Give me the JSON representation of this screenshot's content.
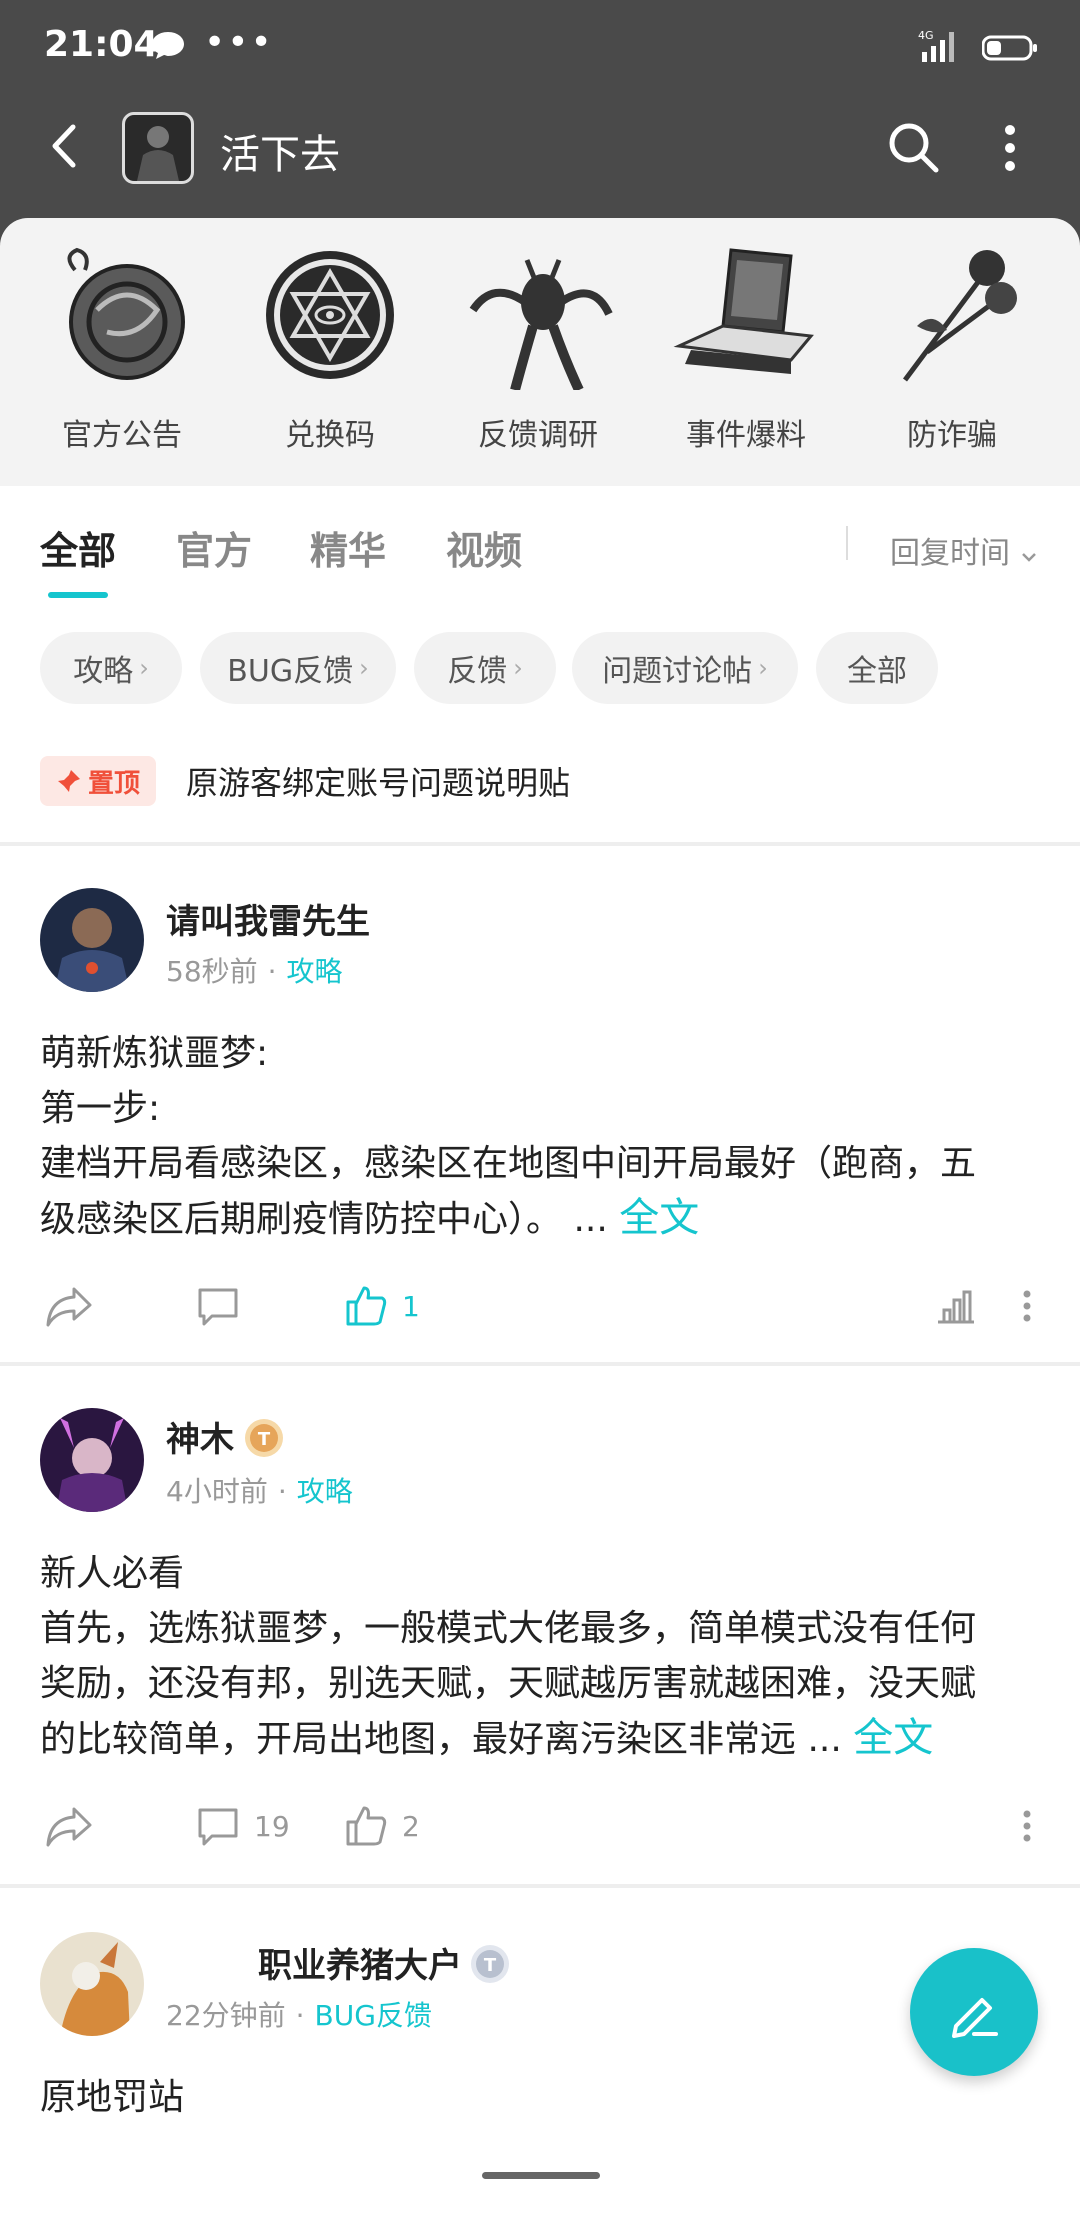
{
  "status_bar": {
    "time": "21:04",
    "more": "•••",
    "network": "4G"
  },
  "topbar": {
    "title": "活下去"
  },
  "categories": [
    {
      "label": "官方公告",
      "icon": "dragon-emblem-icon"
    },
    {
      "label": "兑换码",
      "icon": "hexagram-seal-icon"
    },
    {
      "label": "反馈调研",
      "icon": "creature-icon"
    },
    {
      "label": "事件爆料",
      "icon": "laptop-icon"
    },
    {
      "label": "防诈骗",
      "icon": "rose-icon"
    }
  ],
  "tabs": [
    {
      "label": "全部",
      "active": true
    },
    {
      "label": "官方",
      "active": false
    },
    {
      "label": "精华",
      "active": false
    },
    {
      "label": "视频",
      "active": false
    }
  ],
  "sort": {
    "label": "回复时间"
  },
  "chips": [
    {
      "label": "攻略"
    },
    {
      "label": "BUG反馈"
    },
    {
      "label": "反馈"
    },
    {
      "label": "问题讨论帖"
    },
    {
      "label": "全部"
    }
  ],
  "pinned": {
    "badge": "置顶",
    "title": "原游客绑定账号问题说明贴"
  },
  "posts": [
    {
      "author": "请叫我雷先生",
      "time": "58秒前",
      "category": "攻略",
      "lines": [
        "萌新炼狱噩梦:",
        "第一步:",
        "建档开局看感染区，感染区在地图中间开局最好（跑商，五",
        "级感染区后期刷疫情防控中心）。 ..."
      ],
      "more": "全文",
      "comments": "",
      "likes": "1",
      "liked": true
    },
    {
      "author": "神木",
      "time": "4小时前",
      "category": "攻略",
      "lines": [
        "新人必看",
        "首先，选炼狱噩梦，一般模式大佬最多，简单模式没有任何",
        "奖励，还没有邦，别选天赋，天赋越厉害就越困难，没天赋",
        "的比较简单，开局出地图，最好离污染区非常远 ..."
      ],
      "more": "全文",
      "comments": "19",
      "likes": "2",
      "liked": false,
      "level_badge": "T6"
    },
    {
      "author": "职业养猪大户",
      "time": "22分钟前",
      "category": "BUG反馈",
      "lines": [
        "原地罚站"
      ],
      "level_badge": "T2"
    }
  ],
  "colors": {
    "accent": "#15c5ce",
    "header": "#4a4a4a",
    "pin": "#f0503a"
  }
}
